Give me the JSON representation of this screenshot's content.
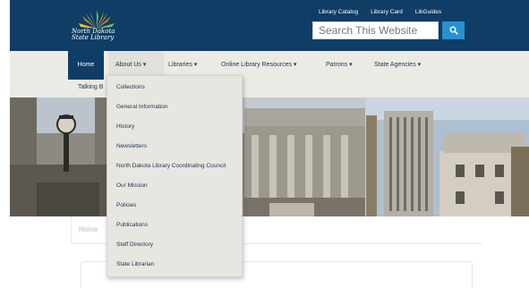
{
  "header": {
    "logo_text_line1": "North Dakota",
    "logo_text_line2": "State Library",
    "utility_links": [
      "Library Catalog",
      "Library Card",
      "LibGuides"
    ],
    "search_placeholder": "Search This Website",
    "search_icon": "search-icon"
  },
  "nav": {
    "items": [
      {
        "label": "Home"
      },
      {
        "label": "About Us ▾"
      },
      {
        "label": "Libraries ▾"
      },
      {
        "label": "Online Library Resources ▾"
      },
      {
        "label": "Patrons ▾"
      },
      {
        "label": "State Agencies ▾"
      }
    ],
    "subnav_label": "Talking B"
  },
  "dropdown": {
    "items": [
      "Collections",
      "General Information",
      "History",
      "Newsletters",
      "North Dakota Library Coordinating Council",
      "Our Mission",
      "Policies",
      "Publications",
      "Staff Directory",
      "State Librarian"
    ]
  },
  "content": {
    "breadcrumb_text": "Home"
  },
  "colors": {
    "header_bg": "#0f3d66",
    "nav_bg": "#eceae5",
    "search_button": "#2a8fd0",
    "dropdown_bg": "#e8e6e1"
  }
}
